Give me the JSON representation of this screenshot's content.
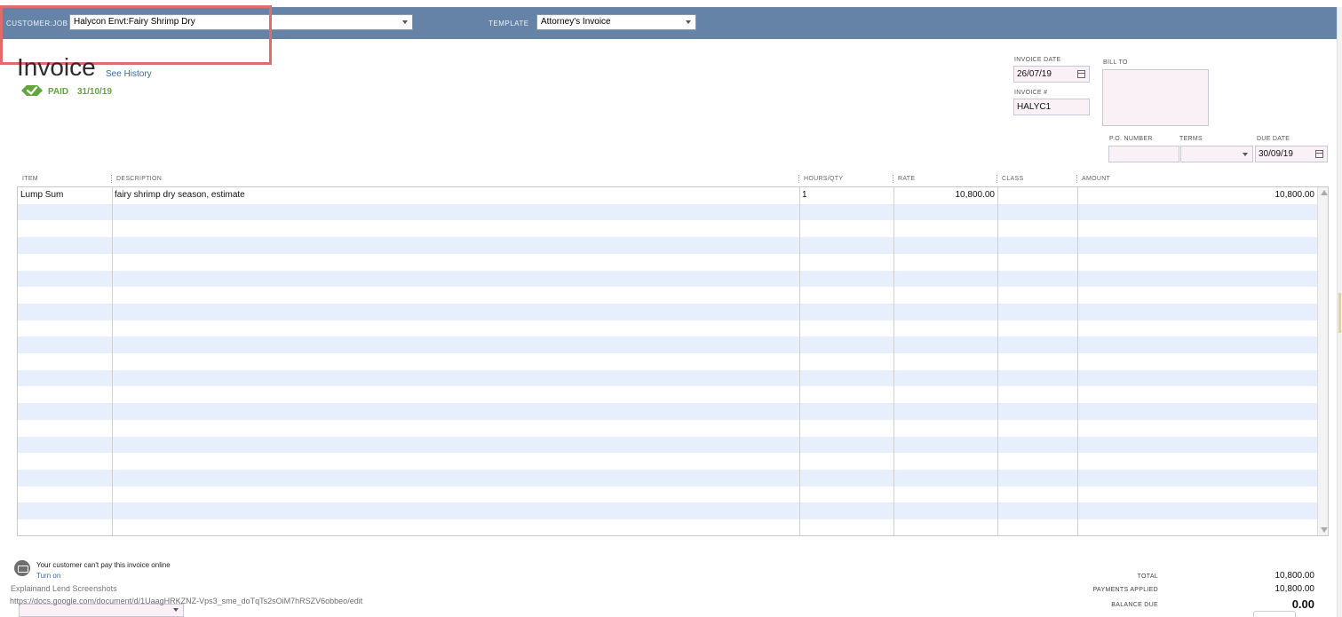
{
  "topbar": {
    "customer_job_label": "CUSTOMER:JOB",
    "customer_job_value": "Halycon Envt:Fairy Shrimp Dry",
    "template_label": "TEMPLATE",
    "template_value": "Attorney's Invoice"
  },
  "invoice": {
    "title": "Invoice",
    "see_history": "See History",
    "status": "PAID",
    "status_date": "31/10/19",
    "status_color": "#62a63d",
    "invoice_date_label": "INVOICE DATE",
    "invoice_date_value": "26/07/19",
    "invoice_number_label": "INVOICE #",
    "invoice_number_value": "HALYC1",
    "bill_to_label": "BILL TO",
    "po_number_label": "P.O. NUMBER",
    "po_number_value": "",
    "terms_label": "TERMS",
    "terms_value": "",
    "due_date_label": "DUE DATE",
    "due_date_value": "30/09/19"
  },
  "table": {
    "columns": [
      "ITEM",
      "DESCRIPTION",
      "HOURS/QTY",
      "RATE",
      "CLASS",
      "AMOUNT"
    ],
    "rows": [
      {
        "item": "Lump Sum",
        "description": "fairy shrimp dry season, estimate",
        "qty": "1",
        "rate": "10,800.00",
        "class": "",
        "amount": "10,800.00"
      }
    ]
  },
  "footer": {
    "online_pay_message": "Your customer can't pay this invoice online",
    "turn_on": "Turn on",
    "overlay_text_1": "Explainand Lend Screenshots",
    "overlay_text_2": "https://docs.google.com/document/d/1UaagHRKZNZ-Vps3_sme_doTqTs2sOiM7hRSZV6obbeo/edit",
    "total_label": "TOTAL",
    "total_value": "10,800.00",
    "payments_applied_label": "PAYMENTS APPLIED",
    "payments_applied_value": "10,800.00",
    "balance_due_label": "BALANCE DUE",
    "balance_due_value": "0.00"
  },
  "colors": {
    "topbar": "#6583a7",
    "row_alt": "#e7eefc",
    "highlight": "#e06b6b",
    "link": "#3a6aa4"
  }
}
